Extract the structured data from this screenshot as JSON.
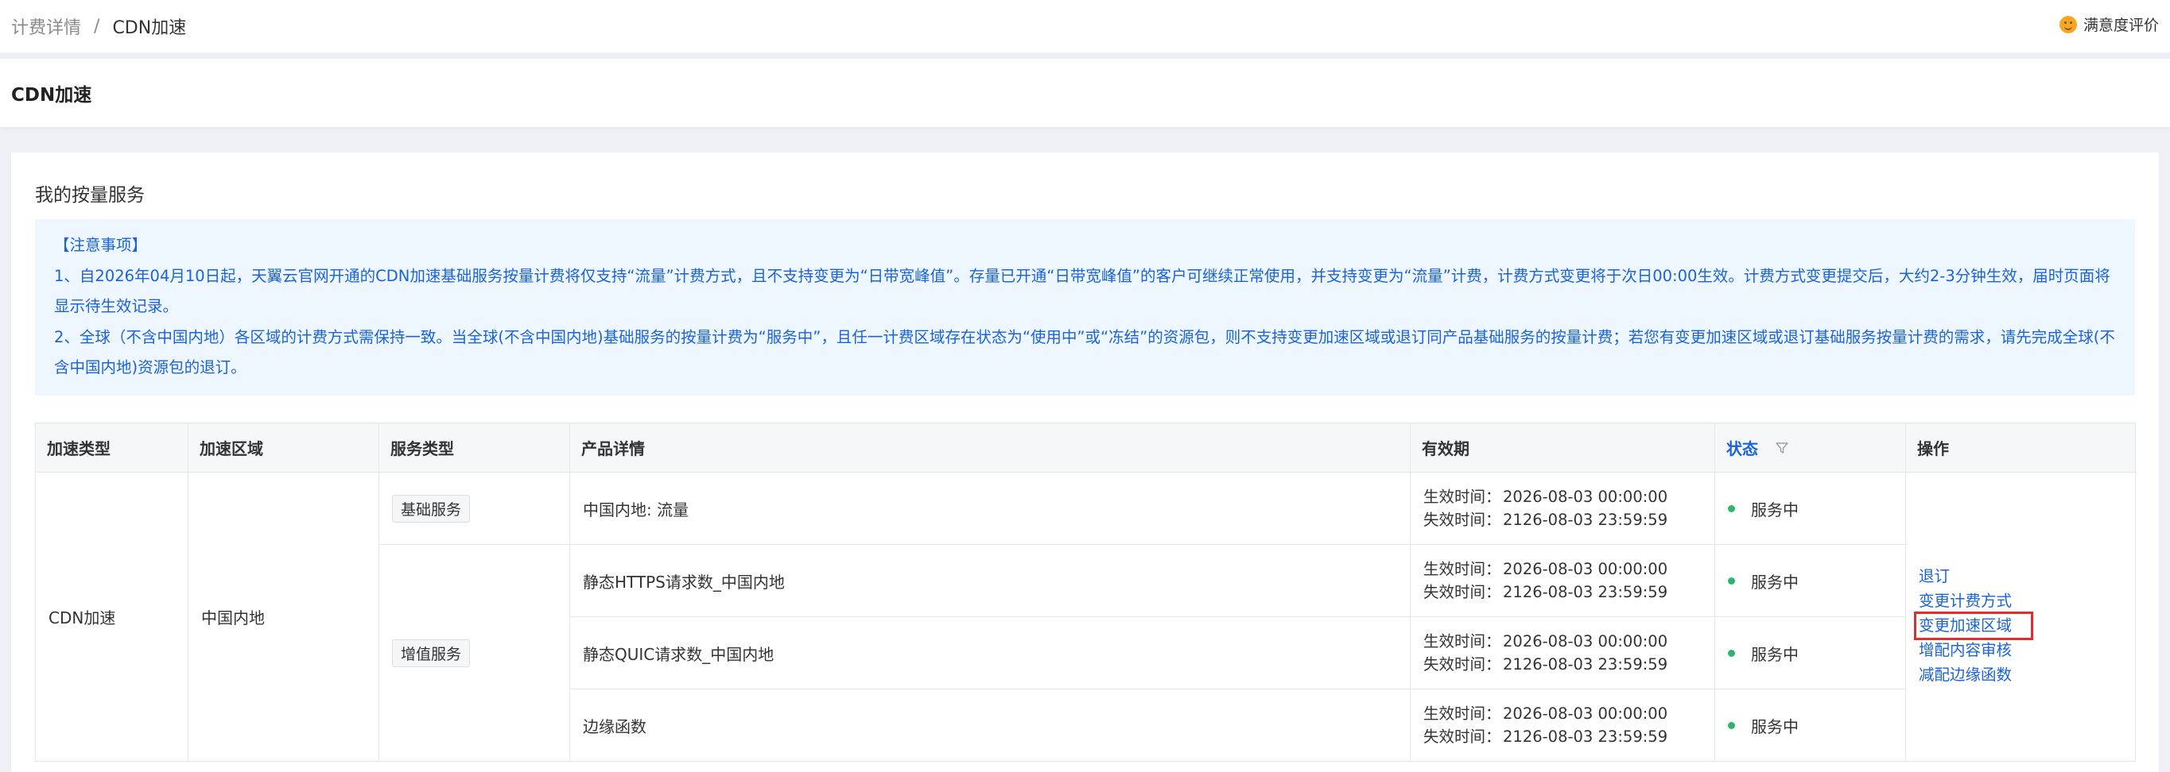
{
  "breadcrumb": {
    "parent": "计费详情",
    "separator": "/",
    "current": "CDN加速"
  },
  "rate_link": "满意度评价",
  "page_title": "CDN加速",
  "card_title": "我的按量服务",
  "notice": {
    "heading": "【注意事项】",
    "item1": "1、自2026年04月10日起，天翼云官网开通的CDN加速基础服务按量计费将仅支持“流量”计费方式，且不支持变更为“日带宽峰值”。存量已开通“日带宽峰值”的客户可继续正常使用，并支持变更为“流量”计费，计费方式变更将于次日00:00生效。计费方式变更提交后，大约2-3分钟生效，届时页面将显示待生效记录。",
    "item2": "2、全球（不含中国内地）各区域的计费方式需保持一致。当全球(不含中国内地)基础服务的按量计费为“服务中”，且任一计费区域存在状态为“使用中”或“冻结”的资源包，则不支持变更加速区域或退订同产品基础服务的按量计费；若您有变更加速区域或退订基础服务按量计费的需求，请先完成全球(不含中国内地)资源包的退订。"
  },
  "table": {
    "headers": {
      "accel_type": "加速类型",
      "accel_region": "加速区域",
      "service_type": "服务类型",
      "product_detail": "产品详情",
      "validity": "有效期",
      "status": "状态",
      "operation": "操作"
    },
    "accel_type": "CDN加速",
    "accel_region": "中国内地",
    "service_basic": "基础服务",
    "service_value_added": "增值服务",
    "effective_label": "生效时间：",
    "expire_label": "失效时间：",
    "rows": [
      {
        "product": "中国内地: 流量",
        "effective": "2026-08-03 00:00:00",
        "expire": "2126-08-03 23:59:59",
        "status": "服务中"
      },
      {
        "product": "静态HTTPS请求数_中国内地",
        "effective": "2026-08-03 00:00:00",
        "expire": "2126-08-03 23:59:59",
        "status": "服务中"
      },
      {
        "product": "静态QUIC请求数_中国内地",
        "effective": "2026-08-03 00:00:00",
        "expire": "2126-08-03 23:59:59",
        "status": "服务中"
      },
      {
        "product": "边缘函数",
        "effective": "2026-08-03 00:00:00",
        "expire": "2126-08-03 23:59:59",
        "status": "服务中"
      }
    ],
    "operations": [
      "退订",
      "变更计费方式",
      "变更加速区域",
      "增配内容审核",
      "减配边缘函数"
    ]
  },
  "colors": {
    "link": "#1a63d8",
    "status_active": "#2fb46c",
    "highlight": "#e02d2d",
    "notice_bg": "#eef6ff"
  }
}
